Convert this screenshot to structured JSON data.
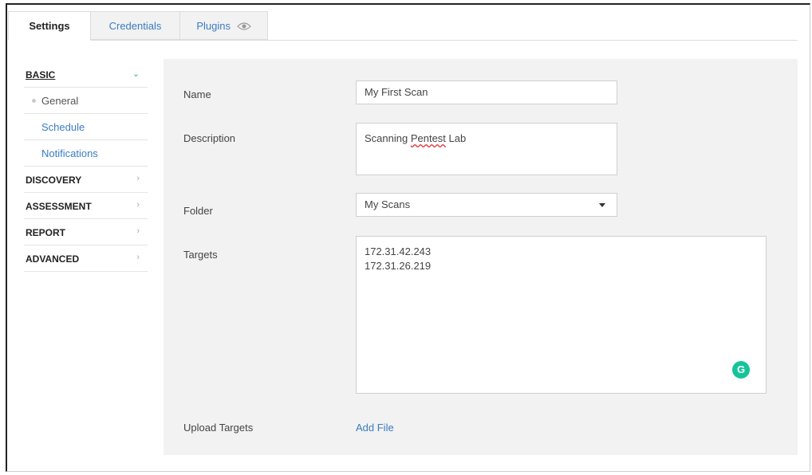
{
  "tabs": [
    {
      "label": "Settings"
    },
    {
      "label": "Credentials"
    },
    {
      "label": "Plugins"
    }
  ],
  "sidebar": {
    "basic": {
      "label": "BASIC",
      "subitems": [
        {
          "label": "General"
        },
        {
          "label": "Schedule"
        },
        {
          "label": "Notifications"
        }
      ]
    },
    "sections": [
      {
        "label": "DISCOVERY"
      },
      {
        "label": "ASSESSMENT"
      },
      {
        "label": "REPORT"
      },
      {
        "label": "ADVANCED"
      }
    ]
  },
  "form": {
    "name": {
      "label": "Name",
      "value": "My First Scan"
    },
    "description": {
      "label": "Description",
      "value_plain": "Scanning ",
      "value_flagged": "Pentest",
      "value_rest": " Lab"
    },
    "folder": {
      "label": "Folder",
      "value": "My Scans"
    },
    "targets": {
      "label": "Targets",
      "lines": [
        "172.31.42.243",
        "172.31.26.219"
      ]
    },
    "upload": {
      "label": "Upload Targets",
      "link": "Add File"
    }
  },
  "colors": {
    "link": "#3a7cc3",
    "panel_bg": "#f2f2f2",
    "grammarly": "#15c39a",
    "chevron_open": "#3cb371"
  },
  "icons": {
    "plugins_tab": "eye-icon",
    "grammarly": "grammarly-icon",
    "basic_chevron": "chevron-down-icon",
    "section_chevron": "chevron-right-icon",
    "folder_select": "caret-down-icon"
  }
}
